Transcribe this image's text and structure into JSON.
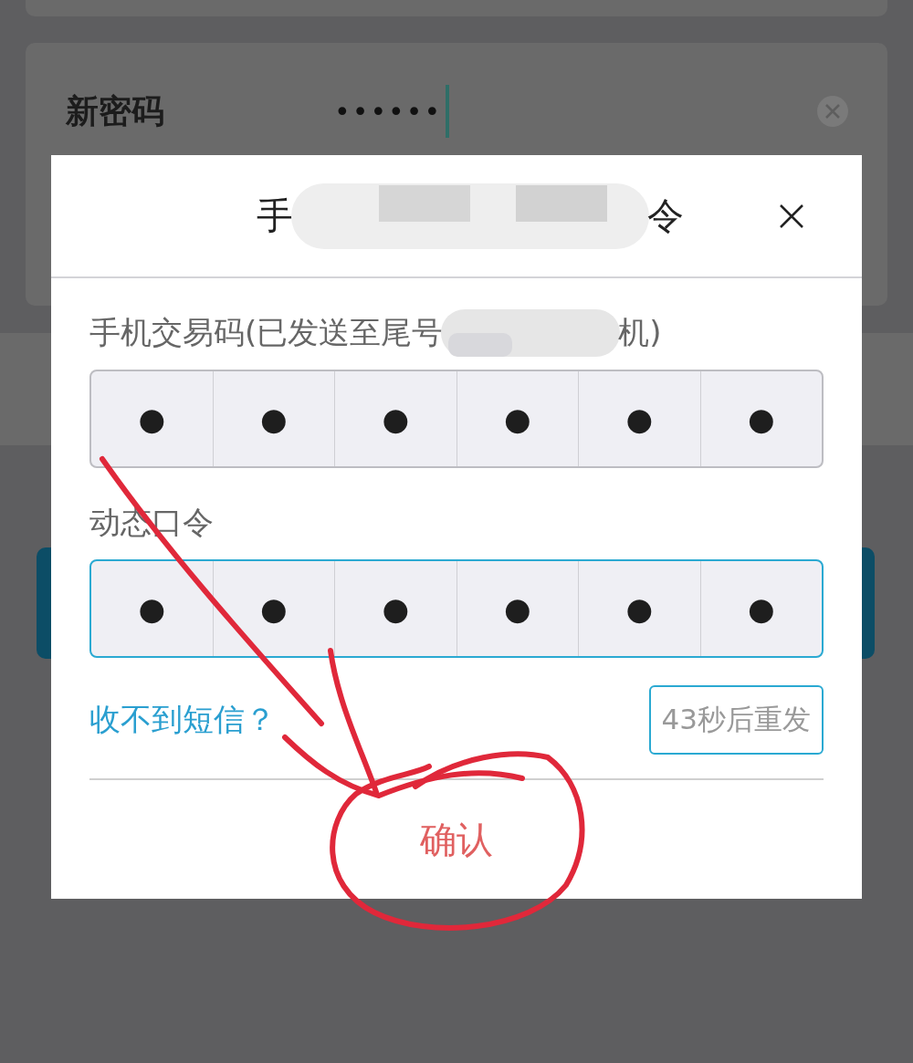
{
  "background": {
    "password_field": {
      "label": "新密码",
      "value": "••••••"
    }
  },
  "dialog": {
    "title_parts": [
      "手",
      "令"
    ],
    "fields": [
      {
        "label_parts": [
          "手机交易码(已发送至尾号",
          "机)"
        ],
        "digits": [
          "●",
          "●",
          "●",
          "●",
          "●",
          "●"
        ],
        "focused": false
      },
      {
        "label_parts": [
          "动态口令"
        ],
        "digits": [
          "●",
          "●",
          "●",
          "●",
          "●",
          "●"
        ],
        "focused": true
      }
    ],
    "help_link": "收不到短信？",
    "resend_button": "43秒后重发",
    "confirm_button": "确认"
  }
}
